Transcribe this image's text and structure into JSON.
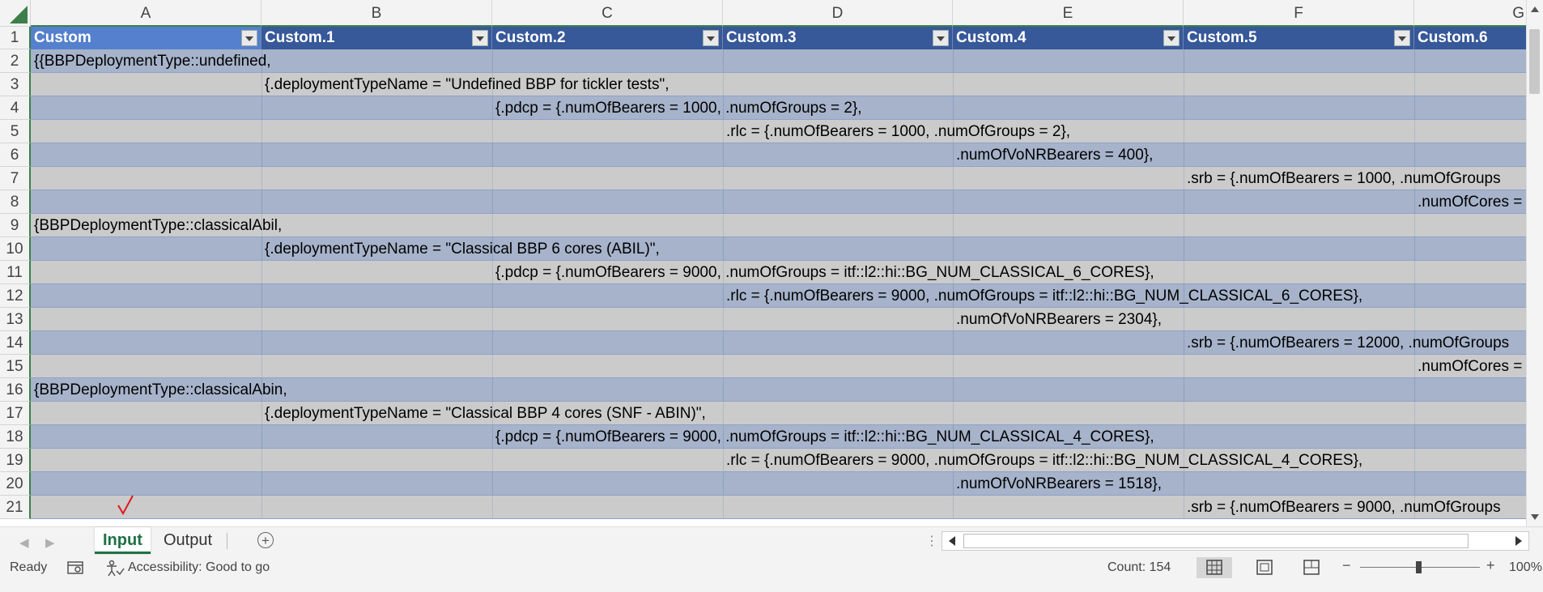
{
  "columns": [
    "A",
    "B",
    "C",
    "D",
    "E",
    "F",
    "G"
  ],
  "table_headers": [
    "Custom",
    "Custom.1",
    "Custom.2",
    "Custom.3",
    "Custom.4",
    "Custom.5",
    "Custom.6"
  ],
  "rows": [
    {
      "num": "2",
      "col": 0,
      "text": "{{BBPDeploymentType::undefined,"
    },
    {
      "num": "3",
      "col": 1,
      "text": "{.deploymentTypeName = \"Undefined BBP for tickler tests\","
    },
    {
      "num": "4",
      "col": 2,
      "text": "{.pdcp = {.numOfBearers = 1000, .numOfGroups = 2},"
    },
    {
      "num": "5",
      "col": 3,
      "text": ".rlc = {.numOfBearers = 1000, .numOfGroups = 2},"
    },
    {
      "num": "6",
      "col": 4,
      "text": ".numOfVoNRBearers = 400},"
    },
    {
      "num": "7",
      "col": 5,
      "text": ".srb = {.numOfBearers = 1000, .numOfGroups"
    },
    {
      "num": "8",
      "col": 6,
      "text": ".numOfCores ="
    },
    {
      "num": "9",
      "col": 0,
      "text": "{BBPDeploymentType::classicalAbil,"
    },
    {
      "num": "10",
      "col": 1,
      "text": "{.deploymentTypeName = \"Classical BBP 6 cores (ABIL)\","
    },
    {
      "num": "11",
      "col": 2,
      "text": "{.pdcp = {.numOfBearers = 9000, .numOfGroups = itf::l2::hi::BG_NUM_CLASSICAL_6_CORES},"
    },
    {
      "num": "12",
      "col": 3,
      "text": ".rlc = {.numOfBearers = 9000, .numOfGroups = itf::l2::hi::BG_NUM_CLASSICAL_6_CORES},"
    },
    {
      "num": "13",
      "col": 4,
      "text": ".numOfVoNRBearers = 2304},"
    },
    {
      "num": "14",
      "col": 5,
      "text": ".srb = {.numOfBearers = 12000, .numOfGroups"
    },
    {
      "num": "15",
      "col": 6,
      "text": ".numOfCores ="
    },
    {
      "num": "16",
      "col": 0,
      "text": "{BBPDeploymentType::classicalAbin,"
    },
    {
      "num": "17",
      "col": 1,
      "text": "{.deploymentTypeName = \"Classical BBP 4 cores (SNF - ABIN)\","
    },
    {
      "num": "18",
      "col": 2,
      "text": "{.pdcp = {.numOfBearers = 9000, .numOfGroups = itf::l2::hi::BG_NUM_CLASSICAL_4_CORES},"
    },
    {
      "num": "19",
      "col": 3,
      "text": ".rlc = {.numOfBearers = 9000, .numOfGroups = itf::l2::hi::BG_NUM_CLASSICAL_4_CORES},"
    },
    {
      "num": "20",
      "col": 4,
      "text": ".numOfVoNRBearers = 1518},"
    },
    {
      "num": "21",
      "col": 5,
      "text": ".srb = {.numOfBearers = 9000, .numOfGroups"
    }
  ],
  "sheet_tabs": {
    "input": "Input",
    "output": "Output",
    "add": "+"
  },
  "status": {
    "ready": "Ready",
    "accessibility": "Accessibility: Good to go",
    "count": "Count: 154",
    "zoom": "100%",
    "zoom_minus": "−",
    "zoom_plus": "+"
  },
  "colors": {
    "header_fill": "#375899",
    "band_dark": "#a6b3ca",
    "band_light": "#cbcbcb",
    "excel_green": "#1e7145",
    "annotation_red": "#e0161c"
  }
}
